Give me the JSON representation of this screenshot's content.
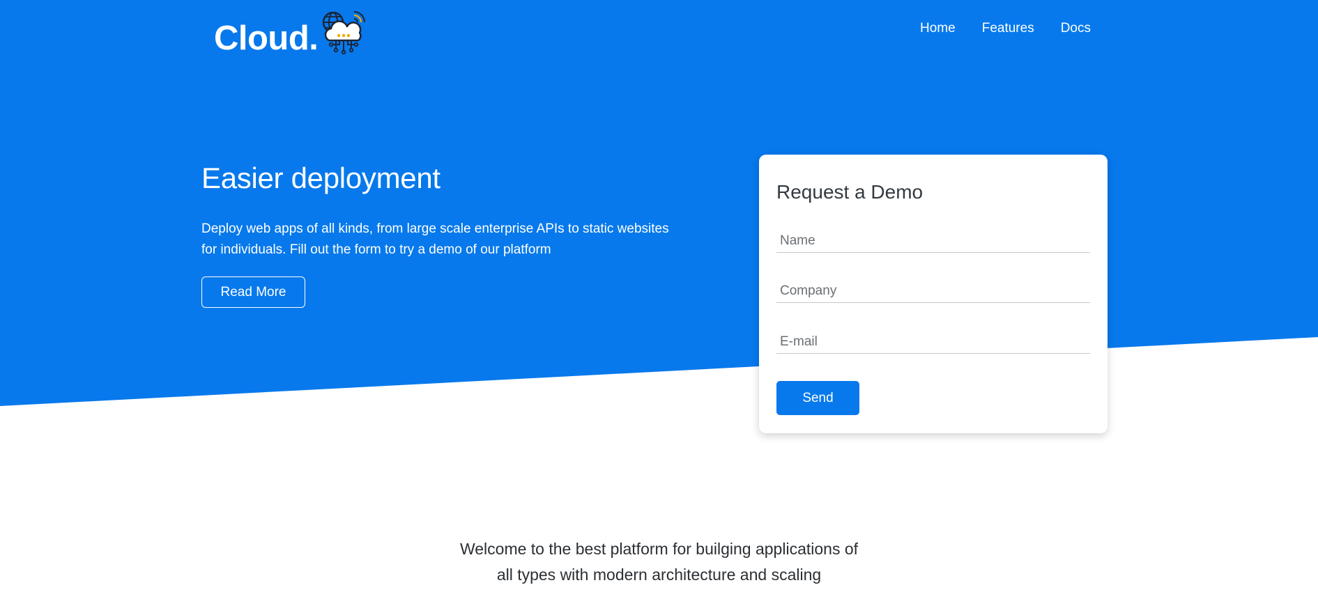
{
  "header": {
    "logo_text": "Cloud.",
    "logo_icon": "cloud-network-icon",
    "nav": [
      {
        "label": "Home"
      },
      {
        "label": "Features"
      },
      {
        "label": "Docs"
      }
    ]
  },
  "hero": {
    "title": "Easier deployment",
    "description_line1": "Deploy web apps of all kinds, from large scale enterprise APIs to static websites",
    "description_line2": "for individuals. Fill out the form to try a demo of our platform",
    "read_more_label": "Read More"
  },
  "demo_form": {
    "title": "Request a Demo",
    "name_placeholder": "Name",
    "company_placeholder": "Company",
    "email_placeholder": "E-mail",
    "send_label": "Send"
  },
  "welcome": {
    "line1": "Welcome to the best platform for builging applications of",
    "line2": "all types with modern architecture and scaling"
  },
  "colors": {
    "primary": "#0779ec",
    "text_dark": "#2b2f33",
    "white": "#ffffff"
  }
}
